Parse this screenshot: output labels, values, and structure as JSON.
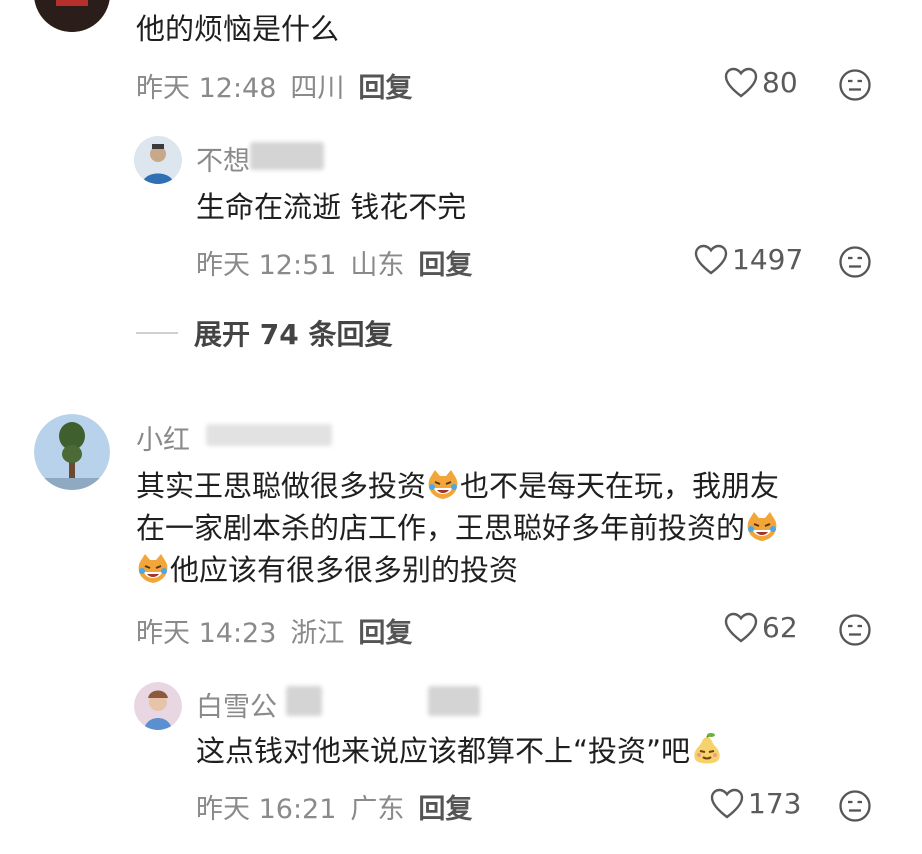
{
  "comments": [
    {
      "text": "他的烦恼是什么",
      "time": "昨天 12:48",
      "location": "四川",
      "reply_label": "回复",
      "likes": "80"
    },
    {
      "username": "不想",
      "text": "生命在流逝 钱花不完",
      "time": "昨天 12:51",
      "location": "山东",
      "reply_label": "回复",
      "likes": "1497"
    },
    {
      "username": "小红",
      "text_lines": [
        "其实王思聪做很多投资",
        "也不是每天在玩，我朋友",
        "在一家剧本杀的店工作，王思聪好多年前投资的",
        "他应该有很多很多别的投资"
      ],
      "time": "昨天 14:23",
      "location": "浙江",
      "reply_label": "回复",
      "likes": "62"
    },
    {
      "username": "白雪公",
      "text_parts": [
        "这点钱对他来说应该都算不上“投资”吧"
      ],
      "time": "昨天 16:21",
      "location": "广东",
      "reply_label": "回复",
      "likes": "173"
    }
  ],
  "expand_replies": "展开 74 条回复",
  "icons": {
    "like": "heart-icon",
    "reaction": "emoji-face-icon",
    "laugh": "laughing-cat-emoji",
    "smirk": "pear-face-emoji"
  },
  "colors": {
    "meta": "#8a8a8a",
    "text": "#1f1f1f"
  }
}
